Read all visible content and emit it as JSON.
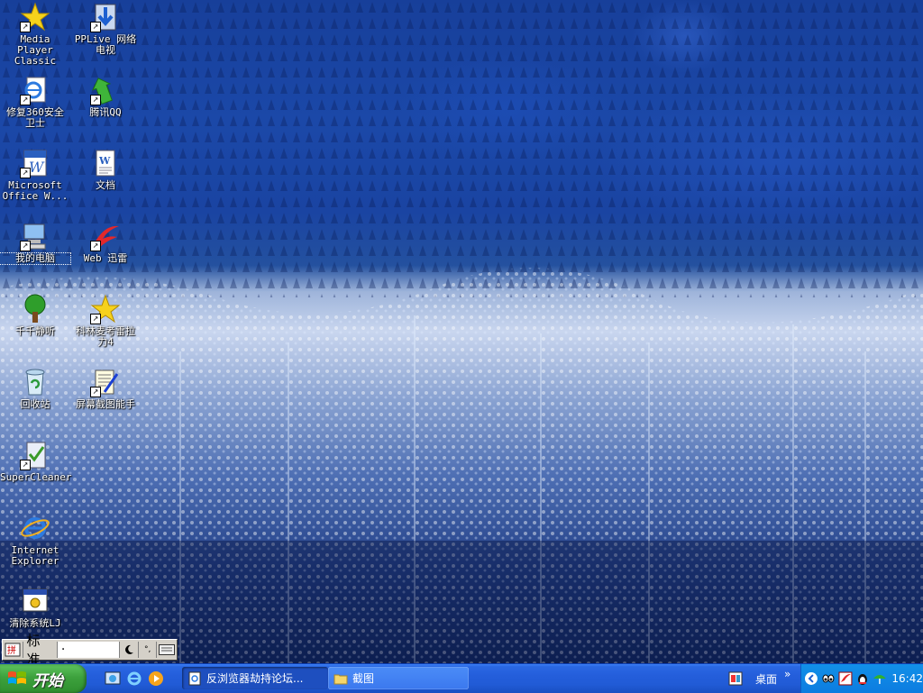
{
  "desktop": {
    "icons": [
      {
        "label": "Media Player\nClassic",
        "icon": "star-icon"
      },
      {
        "label": "PPLive 网络\n电视",
        "icon": "download-arrow-icon"
      },
      {
        "label": "修复360安全\n卫士",
        "icon": "ie-page-icon"
      },
      {
        "label": "腾讯QQ",
        "icon": "green-arrow-icon"
      },
      {
        "label": "Microsoft\nOffice W...",
        "icon": "word-icon"
      },
      {
        "label": "文档",
        "icon": "word-document-icon"
      },
      {
        "label": "我的电脑",
        "icon": "computer-icon"
      },
      {
        "label": "Web 迅雷",
        "icon": "thunder-icon"
      },
      {
        "label": "千千静听",
        "icon": "tree-icon"
      },
      {
        "label": "科林麦考雷拉\n力4",
        "icon": "star-icon"
      },
      {
        "label": "回收站",
        "icon": "recycle-bin-icon"
      },
      {
        "label": "屏幕截图能手",
        "icon": "screenshot-tool-icon"
      },
      {
        "label": "SuperCleaner",
        "icon": "cleaner-icon"
      },
      {
        "label": "Internet\nExplorer",
        "icon": "internet-explorer-icon"
      },
      {
        "label": "清除系统LJ",
        "icon": "system-window-icon"
      }
    ]
  },
  "langbar": {
    "ime_label": "标准",
    "ime_status": "·"
  },
  "taskbar": {
    "start_label": "开始",
    "tasks": [
      {
        "label": "反浏览器劫持论坛...",
        "icon": "document-icon",
        "state": "active"
      },
      {
        "label": "截图",
        "icon": "folder-icon",
        "state": "inactive"
      }
    ],
    "desktop_toolbar_label": "桌面",
    "clock": "16:42"
  }
}
